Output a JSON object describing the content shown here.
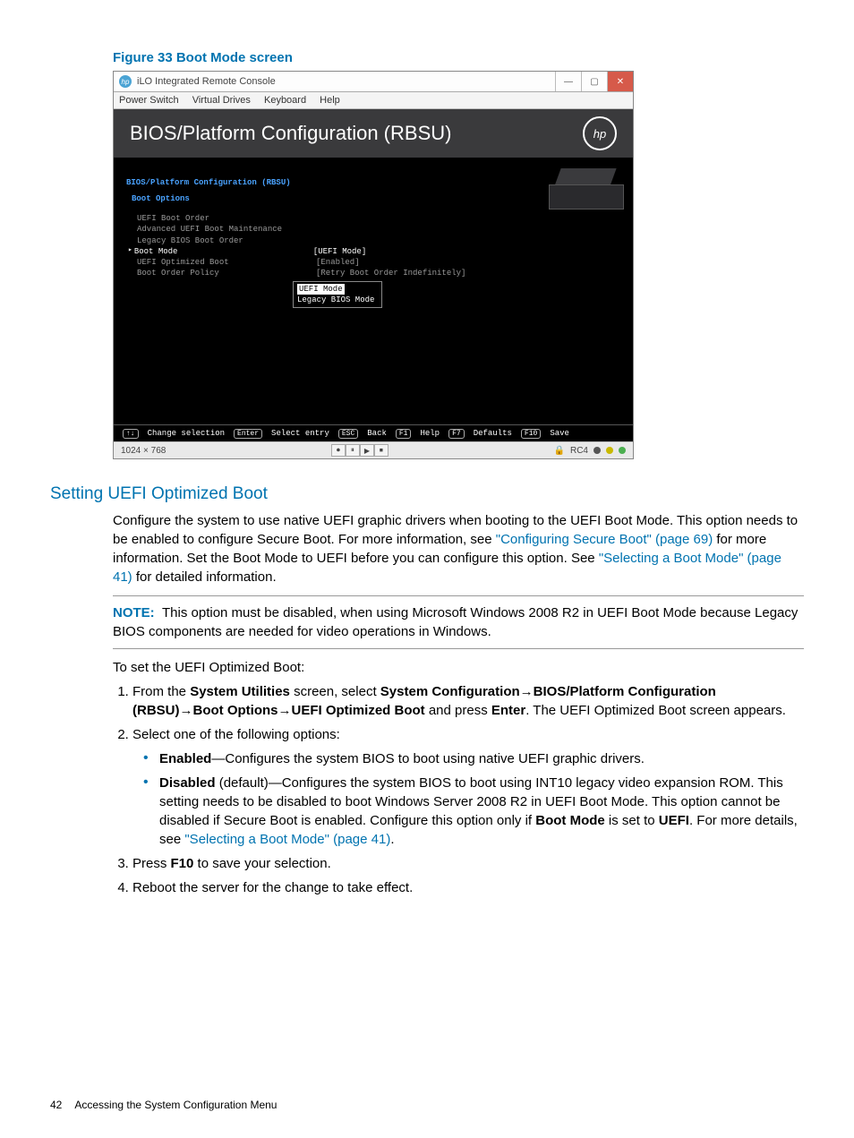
{
  "figure": {
    "caption": "Figure 33 Boot Mode screen"
  },
  "window": {
    "title": "iLO Integrated Remote Console",
    "menus": [
      "Power Switch",
      "Virtual Drives",
      "Keyboard",
      "Help"
    ],
    "win_btn_min": "—",
    "win_btn_max": "▢",
    "win_btn_close": "✕"
  },
  "bios": {
    "header": "BIOS/Platform Configuration (RBSU)",
    "hp_badge": "hp",
    "bc1": "BIOS/Platform Configuration (RBSU)",
    "bc2": "Boot Options",
    "options": [
      {
        "label": "UEFI Boot Order",
        "value": ""
      },
      {
        "label": "Advanced UEFI Boot Maintenance",
        "value": ""
      },
      {
        "label": "Legacy BIOS Boot Order",
        "value": ""
      },
      {
        "label": "Boot Mode",
        "value": "[UEFI Mode]",
        "selected": true
      },
      {
        "label": "UEFI Optimized Boot",
        "value": "[Enabled]"
      },
      {
        "label": "Boot Order Policy",
        "value": "[Retry Boot Order Indefinitely]"
      }
    ],
    "popup": {
      "selected": "UEFI Mode",
      "other": "Legacy BIOS Mode"
    },
    "footer": [
      {
        "key": "↑↓",
        "label": "Change selection"
      },
      {
        "key": "Enter",
        "label": "Select entry"
      },
      {
        "key": "ESC",
        "label": "Back"
      },
      {
        "key": "F1",
        "label": "Help"
      },
      {
        "key": "F7",
        "label": "Defaults"
      },
      {
        "key": "F10",
        "label": "Save"
      }
    ]
  },
  "statusbar": {
    "res": "1024 × 768",
    "enc": "RC4"
  },
  "section": {
    "heading": "Setting UEFI Optimized Boot",
    "intro_1": "Configure the system to use native UEFI graphic drivers when booting to the UEFI Boot Mode. This option needs to be enabled to configure Secure Boot. For more information, see ",
    "link_secure": "\"Configuring Secure Boot\" (page 69)",
    "intro_2": " for more information. Set the Boot Mode to UEFI before you can configure this option. See ",
    "link_bootmode": "\"Selecting a Boot Mode\" (page 41)",
    "intro_3": " for detailed information.",
    "note_label": "NOTE:",
    "note_text": "This option must be disabled, when using Microsoft Windows 2008 R2 in UEFI Boot Mode because Legacy BIOS components are needed for video operations in Windows.",
    "lead": "To set the UEFI Optimized Boot:",
    "step1_a": "From the ",
    "step1_su": "System Utilities",
    "step1_b": " screen, select ",
    "step1_path1": "System Configuration",
    "step1_path2": "BIOS/Platform Configuration (RBSU)",
    "step1_path3": "Boot Options",
    "step1_path4": "UEFI Optimized Boot",
    "step1_c": " and press ",
    "step1_enter": "Enter",
    "step1_d": ". The UEFI Optimized Boot screen appears.",
    "step2": "Select one of the following options:",
    "opt_en_b": "Enabled",
    "opt_en": "—Configures the system BIOS to boot using native UEFI graphic drivers.",
    "opt_dis_b": "Disabled",
    "opt_dis_a": " (default)—Configures the system BIOS to boot using INT10 legacy video expansion ROM. This setting needs to be disabled to boot Windows Server 2008 R2 in UEFI Boot Mode. This option cannot be disabled if Secure Boot is enabled. Configure this option only if ",
    "opt_dis_bm": "Boot Mode",
    "opt_dis_b2": " is set to ",
    "opt_dis_uefi": "UEFI",
    "opt_dis_c": ". For more details, see ",
    "opt_dis_link": "\"Selecting a Boot Mode\" (page 41)",
    "opt_dis_d": ".",
    "step3_a": "Press ",
    "step3_f10": "F10",
    "step3_b": " to save your selection.",
    "step4": "Reboot the server for the change to take effect."
  },
  "footer": {
    "page": "42",
    "title": "Accessing the System Configuration Menu"
  }
}
